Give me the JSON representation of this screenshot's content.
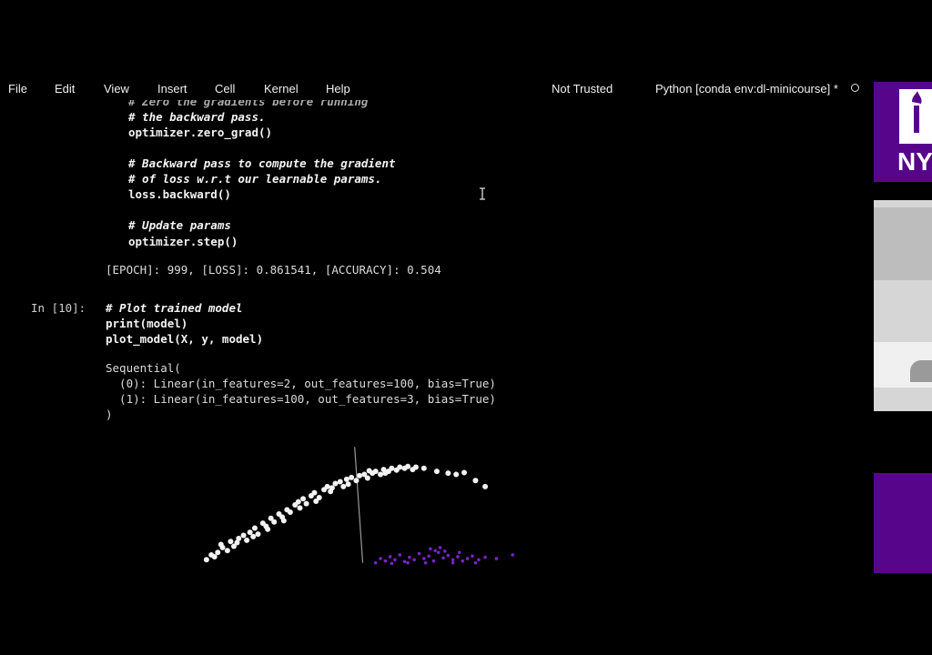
{
  "menu": {
    "items": [
      "File",
      "Edit",
      "View",
      "Insert",
      "Cell",
      "Kernel",
      "Help"
    ],
    "trust": "Not Trusted",
    "kernel": "Python [conda env:dl-minicourse] *"
  },
  "cell9": {
    "partial_top": "# Zero the gradients before running",
    "lines": [
      "# the backward pass.",
      "optimizer.zero_grad()",
      "",
      "# Backward pass to compute the gradient",
      "# of loss w.r.t our learnable params.",
      "loss.backward()",
      "",
      "# Update params",
      "optimizer.step()"
    ],
    "output": "[EPOCH]: 999, [LOSS]: 0.861541, [ACCURACY]: 0.504"
  },
  "cell10": {
    "prompt": "In [10]:",
    "lines": [
      "# Plot trained model",
      "print(model)",
      "plot_model(X, y, model)"
    ],
    "output": [
      "Sequential(",
      "  (0): Linear(in_features=2, out_features=100, bias=True)",
      "  (1): Linear(in_features=100, out_features=3, bias=True)",
      ")"
    ]
  },
  "side_panel": {
    "logo_text": "NY",
    "colors": {
      "purple": "#57068c",
      "grey": "#d0d0d0"
    }
  },
  "chart_data": {
    "type": "scatter",
    "title": "",
    "xlabel": "",
    "ylabel": "",
    "grid": false,
    "series": [
      {
        "color": "#f2f2f2",
        "points": [
          [
            -0.95,
            -0.9
          ],
          [
            -0.9,
            -0.85
          ],
          [
            -0.88,
            -0.78
          ],
          [
            -0.85,
            -0.7
          ],
          [
            -0.82,
            -0.75
          ],
          [
            -0.8,
            -0.6
          ],
          [
            -0.78,
            -0.68
          ],
          [
            -0.75,
            -0.55
          ],
          [
            -0.72,
            -0.5
          ],
          [
            -0.7,
            -0.58
          ],
          [
            -0.68,
            -0.45
          ],
          [
            -0.65,
            -0.38
          ],
          [
            -0.63,
            -0.48
          ],
          [
            -0.6,
            -0.3
          ],
          [
            -0.58,
            -0.35
          ],
          [
            -0.55,
            -0.22
          ],
          [
            -0.53,
            -0.28
          ],
          [
            -0.5,
            -0.15
          ],
          [
            -0.48,
            -0.2
          ],
          [
            -0.45,
            -0.08
          ],
          [
            -0.43,
            -0.12
          ],
          [
            -0.4,
            0.0
          ],
          [
            -0.38,
            0.05
          ],
          [
            -0.35,
            0.1
          ],
          [
            -0.33,
            0.02
          ],
          [
            -0.3,
            0.15
          ],
          [
            -0.28,
            0.2
          ],
          [
            -0.25,
            0.12
          ],
          [
            -0.22,
            0.25
          ],
          [
            -0.2,
            0.3
          ],
          [
            -0.18,
            0.22
          ],
          [
            -0.15,
            0.35
          ],
          [
            -0.12,
            0.38
          ],
          [
            -0.1,
            0.3
          ],
          [
            -0.08,
            0.42
          ],
          [
            -0.05,
            0.45
          ],
          [
            -0.02,
            0.4
          ],
          [
            0.0,
            0.48
          ],
          [
            0.03,
            0.5
          ],
          [
            0.05,
            0.44
          ],
          [
            0.08,
            0.52
          ],
          [
            0.1,
            0.55
          ],
          [
            0.13,
            0.5
          ],
          [
            0.15,
            0.58
          ],
          [
            0.18,
            0.55
          ],
          [
            0.2,
            0.6
          ],
          [
            0.23,
            0.57
          ],
          [
            0.25,
            0.62
          ],
          [
            0.28,
            0.6
          ],
          [
            0.3,
            0.63
          ],
          [
            0.33,
            0.58
          ],
          [
            0.35,
            0.62
          ],
          [
            0.4,
            0.6
          ],
          [
            0.48,
            0.55
          ],
          [
            0.55,
            0.52
          ],
          [
            0.6,
            0.5
          ],
          [
            0.65,
            0.53
          ],
          [
            0.72,
            0.4
          ],
          [
            0.78,
            0.3
          ],
          [
            -0.92,
            -0.82
          ],
          [
            -0.86,
            -0.65
          ],
          [
            -0.76,
            -0.62
          ],
          [
            -0.66,
            -0.52
          ],
          [
            -0.57,
            -0.4
          ],
          [
            -0.47,
            -0.26
          ],
          [
            -0.37,
            -0.05
          ],
          [
            -0.27,
            0.06
          ],
          [
            -0.17,
            0.28
          ],
          [
            -0.07,
            0.34
          ],
          [
            0.06,
            0.56
          ],
          [
            0.16,
            0.52
          ]
        ]
      },
      {
        "color": "#7a22c8",
        "points": [
          [
            0.1,
            -0.95
          ],
          [
            0.13,
            -0.88
          ],
          [
            0.16,
            -0.92
          ],
          [
            0.19,
            -0.85
          ],
          [
            0.22,
            -0.9
          ],
          [
            0.25,
            -0.82
          ],
          [
            0.28,
            -0.93
          ],
          [
            0.31,
            -0.86
          ],
          [
            0.34,
            -0.9
          ],
          [
            0.37,
            -0.8
          ],
          [
            0.4,
            -0.88
          ],
          [
            0.43,
            -0.84
          ],
          [
            0.46,
            -0.92
          ],
          [
            0.49,
            -0.78
          ],
          [
            0.52,
            -0.87
          ],
          [
            0.55,
            -0.83
          ],
          [
            0.58,
            -0.9
          ],
          [
            0.61,
            -0.85
          ],
          [
            0.64,
            -0.92
          ],
          [
            0.67,
            -0.88
          ],
          [
            0.7,
            -0.84
          ],
          [
            0.74,
            -0.9
          ],
          [
            0.78,
            -0.86
          ],
          [
            0.85,
            -0.88
          ],
          [
            0.95,
            -0.82
          ],
          [
            0.44,
            -0.72
          ],
          [
            0.47,
            -0.75
          ],
          [
            0.5,
            -0.7
          ],
          [
            0.53,
            -0.76
          ],
          [
            0.41,
            -0.95
          ],
          [
            0.58,
            -0.95
          ],
          [
            0.62,
            -0.78
          ],
          [
            0.3,
            -0.95
          ],
          [
            0.2,
            -0.96
          ],
          [
            0.72,
            -0.95
          ]
        ]
      }
    ],
    "decision_boundary": [
      [
        -0.03,
        0.95
      ],
      [
        0.02,
        -0.95
      ]
    ]
  }
}
